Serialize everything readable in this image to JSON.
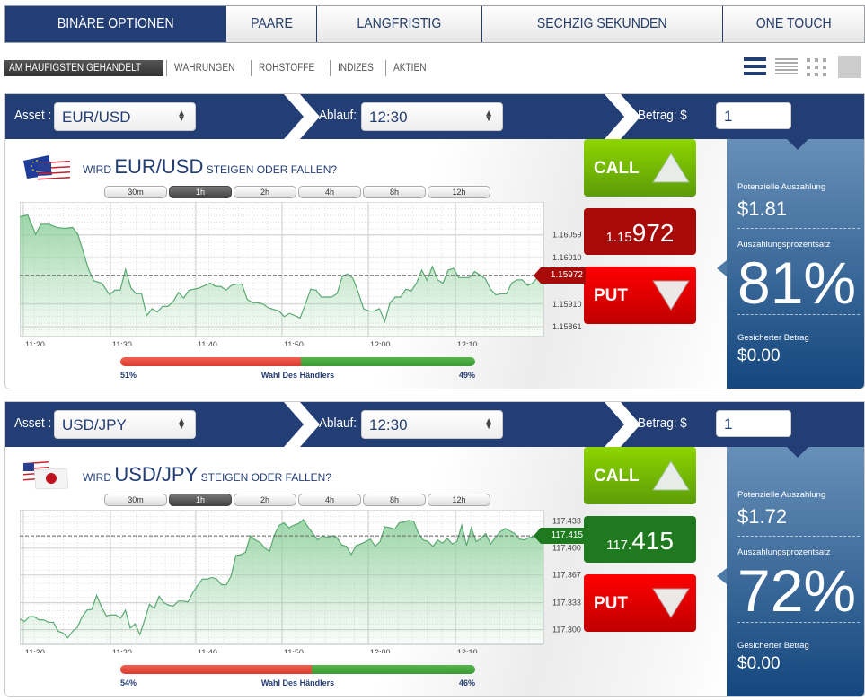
{
  "top_tabs": [
    {
      "label": "BINÄRE OPTIONEN",
      "active": true
    },
    {
      "label": "PAARE",
      "active": false
    },
    {
      "label": "LANGFRISTIG",
      "active": false
    },
    {
      "label": "SECHZIG SEKUNDEN",
      "active": false
    },
    {
      "label": "ONE TOUCH",
      "active": false
    }
  ],
  "sub_nav": [
    {
      "label": "AM HÄUFIGSTEN GEHANDELT",
      "active": true
    },
    {
      "label": "WÄHRUNGEN",
      "active": false
    },
    {
      "label": "ROHSTOFFE",
      "active": false
    },
    {
      "label": "INDIZES",
      "active": false
    },
    {
      "label": "AKTIEN",
      "active": false
    }
  ],
  "view_toggles": [
    "list-large-icon",
    "list-compact-icon",
    "grid-icon",
    "tile-icon"
  ],
  "panels": [
    {
      "asset_label": "Asset :",
      "asset_value": "EUR/USD",
      "expiry_label": "Ablauf:",
      "expiry_value": "12:30",
      "amount_label": "Betrag: $",
      "amount_value": "1",
      "question_prefix": "WIRD",
      "question_asset": "EUR/USD",
      "question_suffix": "STEIGEN ODER FALLEN?",
      "flags": "EU/US",
      "timeframes": [
        {
          "label": "30m",
          "active": false
        },
        {
          "label": "1h",
          "active": true
        },
        {
          "label": "2h",
          "active": false
        },
        {
          "label": "4h",
          "active": false
        },
        {
          "label": "8h",
          "active": false
        },
        {
          "label": "12h",
          "active": false
        }
      ],
      "call_label": "CALL",
      "put_label": "PUT",
      "price_prefix": "1.15",
      "price_main": "972",
      "price_full": "1.15972",
      "price_direction": "down",
      "price_color": "#a80a0a",
      "trader_left_pct": "51%",
      "trader_right_pct": "49%",
      "trader_left_value": 51,
      "trader_label": "Wahl Des Händlers",
      "payout_label": "Potenzielle Auszahlung",
      "payout_value": "$1.81",
      "percent_label": "Auszahlungsprozentsatz",
      "percent_value": "81%",
      "secured_label": "Gesicherter Betrag",
      "secured_value": "$0.00",
      "chart": {
        "type": "area",
        "x_ticks": [
          "11:20",
          "11:30",
          "11:40",
          "11:50",
          "12:00",
          "12:10"
        ],
        "y_ticks": [
          "1.16059",
          "1.16010",
          "1.15910",
          "1.15861"
        ],
        "y_tick_values": [
          1.16059,
          1.1601,
          1.1591,
          1.15861
        ],
        "current": 1.15972,
        "ylim": [
          1.1584,
          1.1613
        ],
        "xlim_minutes": [
          0,
          60
        ],
        "series": [
          [
            0,
            1.16098
          ],
          [
            1.5,
            1.16102
          ],
          [
            3,
            1.1606
          ],
          [
            4,
            1.16082
          ],
          [
            5.5,
            1.16082
          ],
          [
            7,
            1.16075
          ],
          [
            8.5,
            1.16073
          ],
          [
            10,
            1.16075
          ],
          [
            11,
            1.1606
          ],
          [
            13,
            1.15985
          ],
          [
            14,
            1.1596
          ],
          [
            15.5,
            1.15955
          ],
          [
            17,
            1.1593
          ],
          [
            18,
            1.1594
          ],
          [
            19,
            1.1594
          ],
          [
            20,
            1.15985
          ],
          [
            21,
            1.15945
          ],
          [
            22,
            1.15932
          ],
          [
            23,
            1.15933
          ],
          [
            24,
            1.15885
          ],
          [
            25,
            1.159
          ],
          [
            26,
            1.15893
          ],
          [
            27,
            1.15905
          ],
          [
            28,
            1.15905
          ],
          [
            29,
            1.15915
          ],
          [
            30,
            1.15935
          ],
          [
            31,
            1.15923
          ],
          [
            32,
            1.1594
          ],
          [
            33,
            1.15942
          ],
          [
            34,
            1.15945
          ],
          [
            36,
            1.15955
          ],
          [
            37,
            1.15948
          ],
          [
            38,
            1.15948
          ],
          [
            39,
            1.1594
          ],
          [
            40,
            1.1595
          ],
          [
            41,
            1.15953
          ],
          [
            42,
            1.15953
          ],
          [
            43,
            1.1592
          ],
          [
            44,
            1.15913
          ],
          [
            45,
            1.15913
          ],
          [
            46,
            1.1591
          ],
          [
            47,
            1.15902
          ],
          [
            49,
            1.15895
          ],
          [
            50,
            1.15883
          ],
          [
            51,
            1.1589
          ],
          [
            52,
            1.15885
          ],
          [
            53,
            1.1588
          ],
          [
            54,
            1.1591
          ],
          [
            55,
            1.15942
          ],
          [
            56,
            1.1594
          ],
          [
            57,
            1.15925
          ],
          [
            58,
            1.15925
          ],
          [
            59,
            1.15925
          ],
          [
            60,
            1.15933
          ],
          [
            61,
            1.1597
          ],
          [
            62,
            1.15975
          ],
          [
            63,
            1.15965
          ],
          [
            64,
            1.15935
          ],
          [
            65,
            1.159
          ],
          [
            66,
            1.15895
          ],
          [
            67,
            1.15895
          ],
          [
            68,
            1.159
          ],
          [
            69,
            1.15872
          ],
          [
            70,
            1.15913
          ],
          [
            71,
            1.15925
          ],
          [
            72,
            1.15925
          ],
          [
            73,
            1.15942
          ],
          [
            74,
            1.15938
          ],
          [
            75,
            1.15955
          ],
          [
            76,
            1.15983
          ],
          [
            77,
            1.15961
          ],
          [
            78,
            1.15991
          ],
          [
            79,
            1.15962
          ],
          [
            80,
            1.15955
          ],
          [
            81,
            1.15983
          ],
          [
            82,
            1.15987
          ],
          [
            83,
            1.15967
          ],
          [
            84,
            1.15967
          ],
          [
            85,
            1.15967
          ],
          [
            86,
            1.1598
          ],
          [
            87,
            1.15973
          ],
          [
            88,
            1.15965
          ],
          [
            89,
            1.15942
          ],
          [
            90,
            1.1593
          ],
          [
            91,
            1.15932
          ],
          [
            92,
            1.15932
          ],
          [
            93,
            1.15955
          ],
          [
            94,
            1.15962
          ],
          [
            95,
            1.15962
          ],
          [
            96,
            1.1595
          ],
          [
            97,
            1.15955
          ],
          [
            98,
            1.1597
          ],
          [
            99,
            1.15972
          ]
        ]
      }
    },
    {
      "asset_label": "Asset :",
      "asset_value": "USD/JPY",
      "expiry_label": "Ablauf:",
      "expiry_value": "12:30",
      "amount_label": "Betrag: $",
      "amount_value": "1",
      "question_prefix": "WIRD",
      "question_asset": "USD/JPY",
      "question_suffix": "STEIGEN ODER FALLEN?",
      "flags": "US/JP",
      "timeframes": [
        {
          "label": "30m",
          "active": false
        },
        {
          "label": "1h",
          "active": true
        },
        {
          "label": "2h",
          "active": false
        },
        {
          "label": "4h",
          "active": false
        },
        {
          "label": "8h",
          "active": false
        },
        {
          "label": "12h",
          "active": false
        }
      ],
      "call_label": "CALL",
      "put_label": "PUT",
      "price_prefix": "117.",
      "price_main": "415",
      "price_full": "117.415",
      "price_direction": "up",
      "price_color": "#1f7a1f",
      "trader_left_pct": "54%",
      "trader_right_pct": "46%",
      "trader_left_value": 54,
      "trader_label": "Wahl Des Händlers",
      "payout_label": "Potenzielle Auszahlung",
      "payout_value": "$1.72",
      "percent_label": "Auszahlungsprozentsatz",
      "percent_value": "72%",
      "secured_label": "Gesicherter Betrag",
      "secured_value": "$0.00",
      "chart": {
        "type": "area",
        "x_ticks": [
          "11:20",
          "11:30",
          "11:40",
          "11:50",
          "12:00",
          "12:10"
        ],
        "y_ticks": [
          "117.433",
          "117.400",
          "117.367",
          "117.333",
          "117.300"
        ],
        "y_tick_values": [
          117.433,
          117.4,
          117.367,
          117.333,
          117.3
        ],
        "current": 117.415,
        "ylim": [
          117.282,
          117.447
        ],
        "xlim_minutes": [
          0,
          60
        ],
        "series": [
          [
            0,
            117.313
          ],
          [
            1,
            117.31
          ],
          [
            2,
            117.316
          ],
          [
            3,
            117.316
          ],
          [
            4,
            117.312
          ],
          [
            5,
            117.312
          ],
          [
            6,
            117.309
          ],
          [
            7,
            117.309
          ],
          [
            8,
            117.298
          ],
          [
            9,
            117.296
          ],
          [
            10,
            117.29
          ],
          [
            11,
            117.298
          ],
          [
            12,
            117.303
          ],
          [
            13,
            117.316
          ],
          [
            14,
            117.324
          ],
          [
            15,
            117.325
          ],
          [
            16,
            117.342
          ],
          [
            17,
            117.328
          ],
          [
            18,
            117.317
          ],
          [
            19,
            117.318
          ],
          [
            20,
            117.318
          ],
          [
            21,
            117.314
          ],
          [
            22,
            117.324
          ],
          [
            23,
            117.302
          ],
          [
            24,
            117.307
          ],
          [
            25,
            117.294
          ],
          [
            26,
            117.312
          ],
          [
            27,
            117.331
          ],
          [
            28,
            117.326
          ],
          [
            29,
            117.341
          ],
          [
            30,
            117.333
          ],
          [
            31,
            117.33
          ],
          [
            32,
            117.329
          ],
          [
            33,
            117.335
          ],
          [
            34,
            117.335
          ],
          [
            35,
            117.334
          ],
          [
            36,
            117.345
          ],
          [
            37,
            117.354
          ],
          [
            38,
            117.362
          ],
          [
            39,
            117.362
          ],
          [
            40,
            117.364
          ],
          [
            41,
            117.362
          ],
          [
            42,
            117.355
          ],
          [
            43,
            117.355
          ],
          [
            44,
            117.366
          ],
          [
            45,
            117.391
          ],
          [
            46,
            117.392
          ],
          [
            47,
            117.395
          ],
          [
            48,
            117.415
          ],
          [
            49,
            117.41
          ],
          [
            50,
            117.407
          ],
          [
            51,
            117.4
          ],
          [
            52,
            117.396
          ],
          [
            53,
            117.416
          ],
          [
            54,
            117.428
          ],
          [
            55,
            117.431
          ],
          [
            56,
            117.425
          ],
          [
            57,
            117.428
          ],
          [
            58,
            117.43
          ],
          [
            59,
            117.435
          ],
          [
            60,
            117.426
          ],
          [
            61,
            117.418
          ],
          [
            62,
            117.41
          ],
          [
            63,
            117.415
          ],
          [
            64,
            117.413
          ],
          [
            65,
            117.415
          ],
          [
            66,
            117.413
          ],
          [
            67,
            117.404
          ],
          [
            68,
            117.402
          ],
          [
            69,
            117.392
          ],
          [
            70,
            117.403
          ],
          [
            71,
            117.405
          ],
          [
            72,
            117.408
          ],
          [
            73,
            117.411
          ],
          [
            74,
            117.402
          ],
          [
            75,
            117.408
          ],
          [
            76,
            117.426
          ],
          [
            77,
            117.425
          ],
          [
            78,
            117.423
          ],
          [
            79,
            117.431
          ],
          [
            80,
            117.432
          ],
          [
            81,
            117.434
          ],
          [
            82,
            117.433
          ],
          [
            83,
            117.418
          ],
          [
            84,
            117.41
          ],
          [
            85,
            117.408
          ],
          [
            86,
            117.402
          ],
          [
            87,
            117.41
          ],
          [
            88,
            117.406
          ],
          [
            89,
            117.412
          ],
          [
            90,
            117.405
          ],
          [
            91,
            117.408
          ],
          [
            92,
            117.428
          ],
          [
            93,
            117.403
          ],
          [
            94,
            117.425
          ],
          [
            95,
            117.408
          ],
          [
            96,
            117.412
          ],
          [
            97,
            117.418
          ],
          [
            98,
            117.405
          ],
          [
            99,
            117.413
          ],
          [
            100,
            117.42
          ],
          [
            101,
            117.424
          ],
          [
            102,
            117.421
          ],
          [
            103,
            117.418
          ],
          [
            104,
            117.411
          ],
          [
            105,
            117.41
          ],
          [
            106,
            117.413
          ],
          [
            107,
            117.414
          ],
          [
            108,
            117.414
          ],
          [
            109,
            117.415
          ]
        ]
      }
    }
  ]
}
